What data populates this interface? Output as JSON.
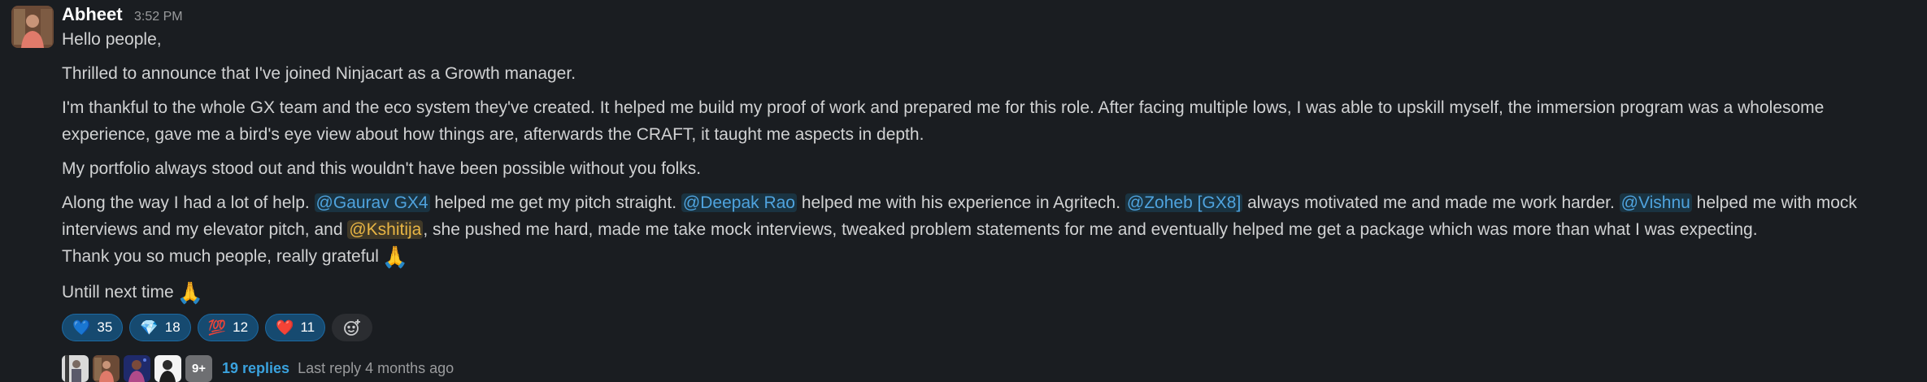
{
  "message": {
    "author": "Abheet",
    "time": "3:52 PM",
    "greeting": "Hello people,",
    "announcement": "Thrilled to announce that I've joined Ninjacart as a Growth manager.",
    "thanks_paragraph": "I'm thankful to the whole GX team and the eco system they've created. It helped me build my proof of work and prepared me for this role. After facing multiple lows, I was able to upskill myself, the immersion program was a wholesome experience, gave me a bird's eye view about how things are, afterwards the CRAFT, it taught me aspects in depth.",
    "portfolio_paragraph": "My portfolio always stood out and this wouldn't have been possible without you folks.",
    "help": {
      "t1": "Along the way I had a lot of help. ",
      "m1": "@Gaurav GX4",
      "t2": " helped me get my pitch straight. ",
      "m2": "@Deepak Rao",
      "t3": " helped me with his experience in Agritech. ",
      "m3": "@Zoheb [GX8]",
      "t4": " always motivated me and made me work harder. ",
      "m4": "@Vishnu",
      "t5": " helped me with mock interviews and my elevator pitch, and ",
      "m5": "@Kshitija",
      "t6": ", she pushed me hard, made me take mock interviews, tweaked problem statements for me and eventually helped me get a package which was more than what I was expecting."
    },
    "thank_you": "Thank you so much people, really grateful",
    "signoff": "Untill next time",
    "pray_emoji": "🙏"
  },
  "reactions": [
    {
      "emoji": "💙",
      "count": "35"
    },
    {
      "emoji": "💎",
      "count": "18"
    },
    {
      "emoji": "💯",
      "count": "12"
    },
    {
      "emoji": "❤️",
      "count": "11"
    }
  ],
  "thread": {
    "more_count": "9+",
    "replies": "19 replies",
    "last_reply": "Last reply 4 months ago"
  },
  "colors": {
    "background": "#1a1d21",
    "mention": "#4fa3de",
    "self_mention": "#e8b544",
    "link": "#3aa2de",
    "reaction_bg": "#164a70"
  }
}
